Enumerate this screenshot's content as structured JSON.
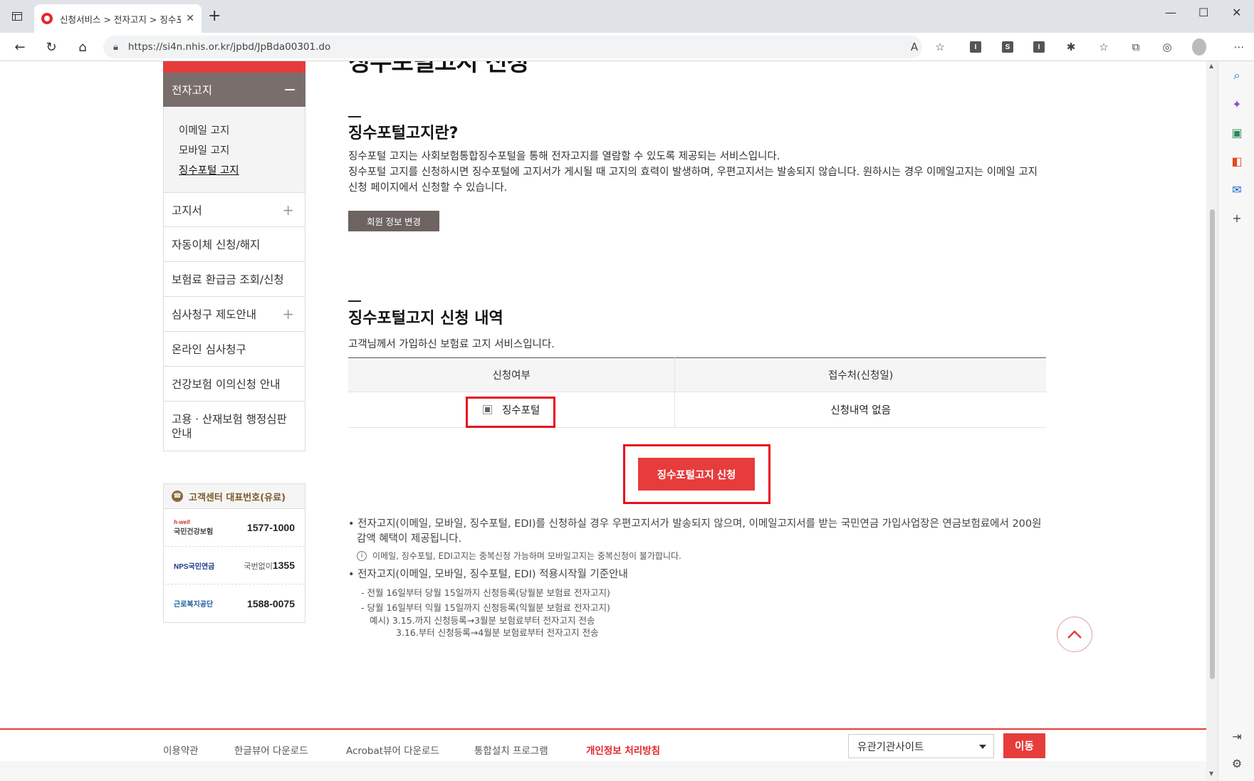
{
  "browser": {
    "tab_title": "신청서비스 > 전자고지 > 징수포",
    "url": "https://si4n.nhis.or.kr/jpbd/JpBda00301.do",
    "ext_labels": [
      "I",
      "S",
      "I"
    ]
  },
  "sidebar": {
    "current": "전자고지",
    "sub_items": [
      "이메일 고지",
      "모바일 고지",
      "징수포털 고지"
    ],
    "items": [
      {
        "label": "고지서",
        "expand": true
      },
      {
        "label": "자동이체 신청/해지",
        "expand": false
      },
      {
        "label": "보험료 환급금 조회/신청",
        "expand": false
      },
      {
        "label": "심사청구 제도안내",
        "expand": true
      },
      {
        "label": "온라인 심사청구",
        "expand": false
      },
      {
        "label": "건강보험 이의신청 안내",
        "expand": false
      },
      {
        "label": "고용ㆍ산재보험 행정심판 안내",
        "expand": false
      }
    ]
  },
  "customer_center": {
    "title": "고객센터 대표번호(유료)",
    "rows": [
      {
        "logo": "국민건강보험",
        "logo_prefix": "h-well",
        "number": "1577-1000"
      },
      {
        "logo": "NPS국민연금",
        "prefix": "국번없이",
        "number": "1355"
      },
      {
        "logo": "근로복지공단",
        "number": "1588-0075"
      }
    ]
  },
  "main": {
    "page_title": "징수포털고지 신청",
    "section1_title": "징수포털고지란?",
    "section1_p1": "징수포털 고지는 사회보험통합징수포털을 통해 전자고지를 열람할 수 있도록 제공되는 서비스입니다.",
    "section1_p2": "징수포털 고지를 신청하시면 징수포털에 고지서가 게시될 때 고지의 효력이 발생하며, 우편고지서는 발송되지 않습니다. 원하시는 경우 이메일고지는 이메일 고지 신청 페이지에서 신청할 수 있습니다.",
    "member_button": "회원 정보 변경",
    "section2_title": "징수포털고지 신청 내역",
    "section2_desc": "고객님께서 가입하신 보험료 고지 서비스입니다.",
    "table": {
      "headers": [
        "신청여부",
        "접수처(신청일)"
      ],
      "row": {
        "option": "징수포털",
        "receipt": "신청내역 없음"
      }
    },
    "apply_button": "징수포털고지 신청",
    "notes": {
      "b1": "전자고지(이메일, 모바일, 징수포털, EDI)를 신청하실 경우 우편고지서가 발송되지 않으며, 이메일고지서를 받는 국민연금 가입사업장은 연금보험료에서 200원 감액 혜택이 제공됩니다.",
      "info": "이메일, 징수포털, EDI고지는 중복신청 가능하며 모바일고지는 중복신청이 불가합니다.",
      "b2": "전자고지(이메일, 모바일, 징수포털, EDI) 적용시작월 기준안내",
      "s1": "- 전월 16일부터 당월 15일까지 신청등록(당월분 보험료 전자고지)",
      "s2": "- 당월 16일부터 익월 15일까지 신청등록(익월분 보험료 전자고지)",
      "s3": "예시) 3.15.까지 신청등록→3월분 보험료부터 전자고지 전송",
      "s4": "3.16.부터 신청등록→4월분 보험료부터 전자고지 전송"
    }
  },
  "footer": {
    "links": [
      "이용약관",
      "한글뷰어 다운로드",
      "Acrobat뷰어 다운로드",
      "통합설치 프로그램",
      "개인정보 처리방침"
    ],
    "select_value": "유관기관사이트",
    "go_button": "이동"
  },
  "colors": {
    "accent": "#e63c3c",
    "nav_current": "#7a6e6c",
    "highlight": "#e5101c"
  }
}
